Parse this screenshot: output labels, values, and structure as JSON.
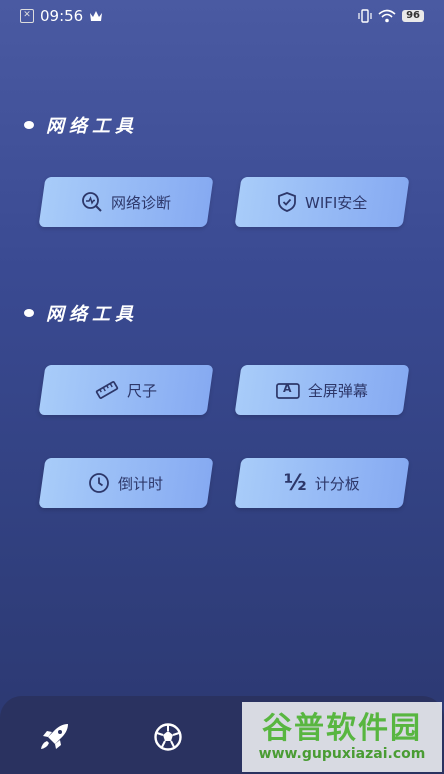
{
  "status_bar": {
    "time": "09:56",
    "battery": "96"
  },
  "sections": [
    {
      "title": "网络工具"
    },
    {
      "title": "网络工具"
    }
  ],
  "tools": {
    "network_diagnosis": "网络诊断",
    "wifi_security": "WIFI安全",
    "ruler": "尺子",
    "fullscreen_barrage": "全屏弹幕",
    "countdown": "倒计时",
    "scoreboard": "计分板"
  },
  "icons": {
    "half_glyph": "½",
    "barrage_glyph": "A"
  },
  "watermark": {
    "title": "谷普软件园",
    "url": "www.gupuxiazai.com"
  },
  "colors": {
    "bg_top": "#4a5aa2",
    "bg_bottom": "#2b376f",
    "button_light": "#a8ccf9",
    "button_dark": "#86aaf2",
    "button_text": "#2d3769",
    "nav_bg": "#2a3260"
  }
}
